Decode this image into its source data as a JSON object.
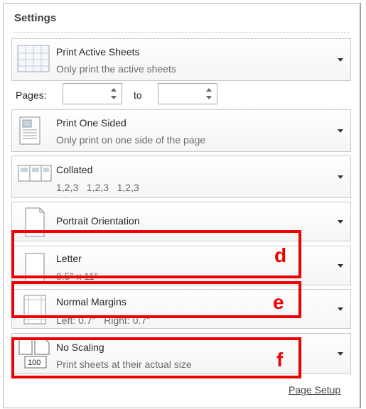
{
  "settings": {
    "title": "Settings"
  },
  "print_what": {
    "title": "Print Active Sheets",
    "subtitle": "Only print the active sheets"
  },
  "pages": {
    "label": "Pages:",
    "from_value": "",
    "to_label": "to",
    "to_value": ""
  },
  "sides": {
    "title": "Print One Sided",
    "subtitle": "Only print on one side of the page"
  },
  "collation": {
    "title": "Collated",
    "subtitle": "1,2,3   1,2,3   1,2,3"
  },
  "orientation": {
    "title": "Portrait Orientation"
  },
  "paper": {
    "title": "Letter",
    "subtitle": "8.5\" x 11\""
  },
  "margins": {
    "title": "Normal Margins",
    "subtitle": "Left: 0.7\"   Right: 0.7\""
  },
  "scaling": {
    "title": "No Scaling",
    "subtitle": "Print sheets at their actual size",
    "icon_text": "100"
  },
  "page_setup_link": "Page Setup",
  "annotations": {
    "d": "d",
    "e": "e",
    "f": "f",
    "color": "#ee0000"
  }
}
